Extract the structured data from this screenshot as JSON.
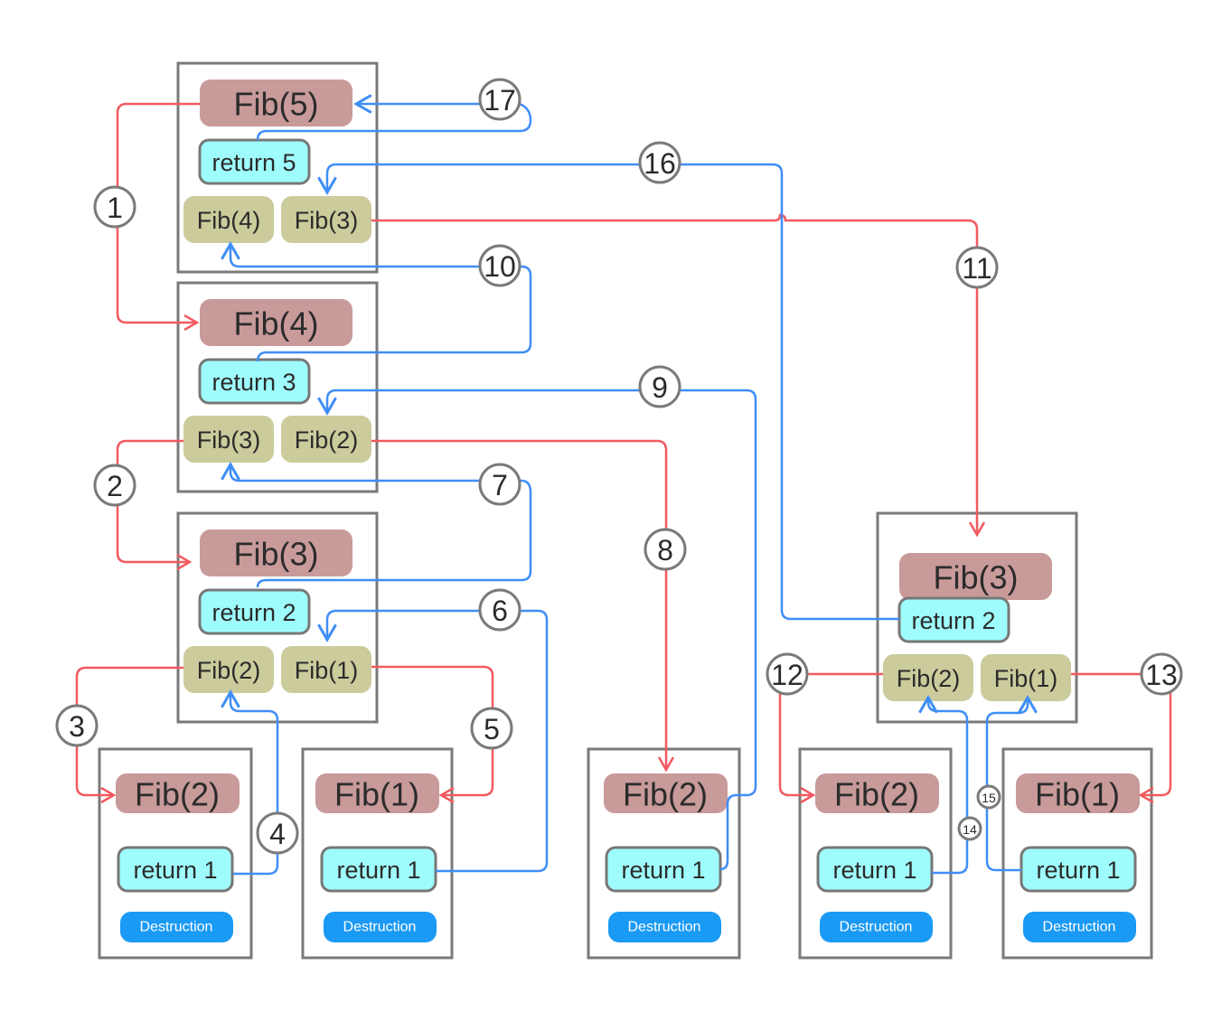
{
  "frames": [
    {
      "call": "Fib(5)",
      "ret": "return 5",
      "subs": [
        "Fib(4)",
        "Fib(3)"
      ]
    },
    {
      "call": "Fib(4)",
      "ret": "return 3",
      "subs": [
        "Fib(3)",
        "Fib(2)"
      ]
    },
    {
      "call": "Fib(3)",
      "ret": "return 2",
      "subs": [
        "Fib(2)",
        "Fib(1)"
      ]
    },
    {
      "call": "Fib(3)",
      "ret": "return 2",
      "subs": [
        "Fib(2)",
        "Fib(1)"
      ]
    },
    {
      "call": "Fib(2)",
      "ret": "return 1",
      "destroy": "Destruction"
    },
    {
      "call": "Fib(1)",
      "ret": "return 1",
      "destroy": "Destruction"
    },
    {
      "call": "Fib(2)",
      "ret": "return 1",
      "destroy": "Destruction"
    },
    {
      "call": "Fib(2)",
      "ret": "return 1",
      "destroy": "Destruction"
    },
    {
      "call": "Fib(1)",
      "ret": "return 1",
      "destroy": "Destruction"
    }
  ],
  "steps": [
    "1",
    "2",
    "3",
    "4",
    "5",
    "6",
    "7",
    "8",
    "9",
    "10",
    "11",
    "12",
    "13",
    "14",
    "15",
    "16",
    "17"
  ],
  "colors": {
    "call_arrow": "#f25a5f",
    "return_arrow": "#3f8ef7",
    "call_box": "#c99a9a",
    "return_box": "#9ffcfc",
    "subcall_box": "#cbcb9c",
    "destruction_button": "#1a9af5"
  }
}
